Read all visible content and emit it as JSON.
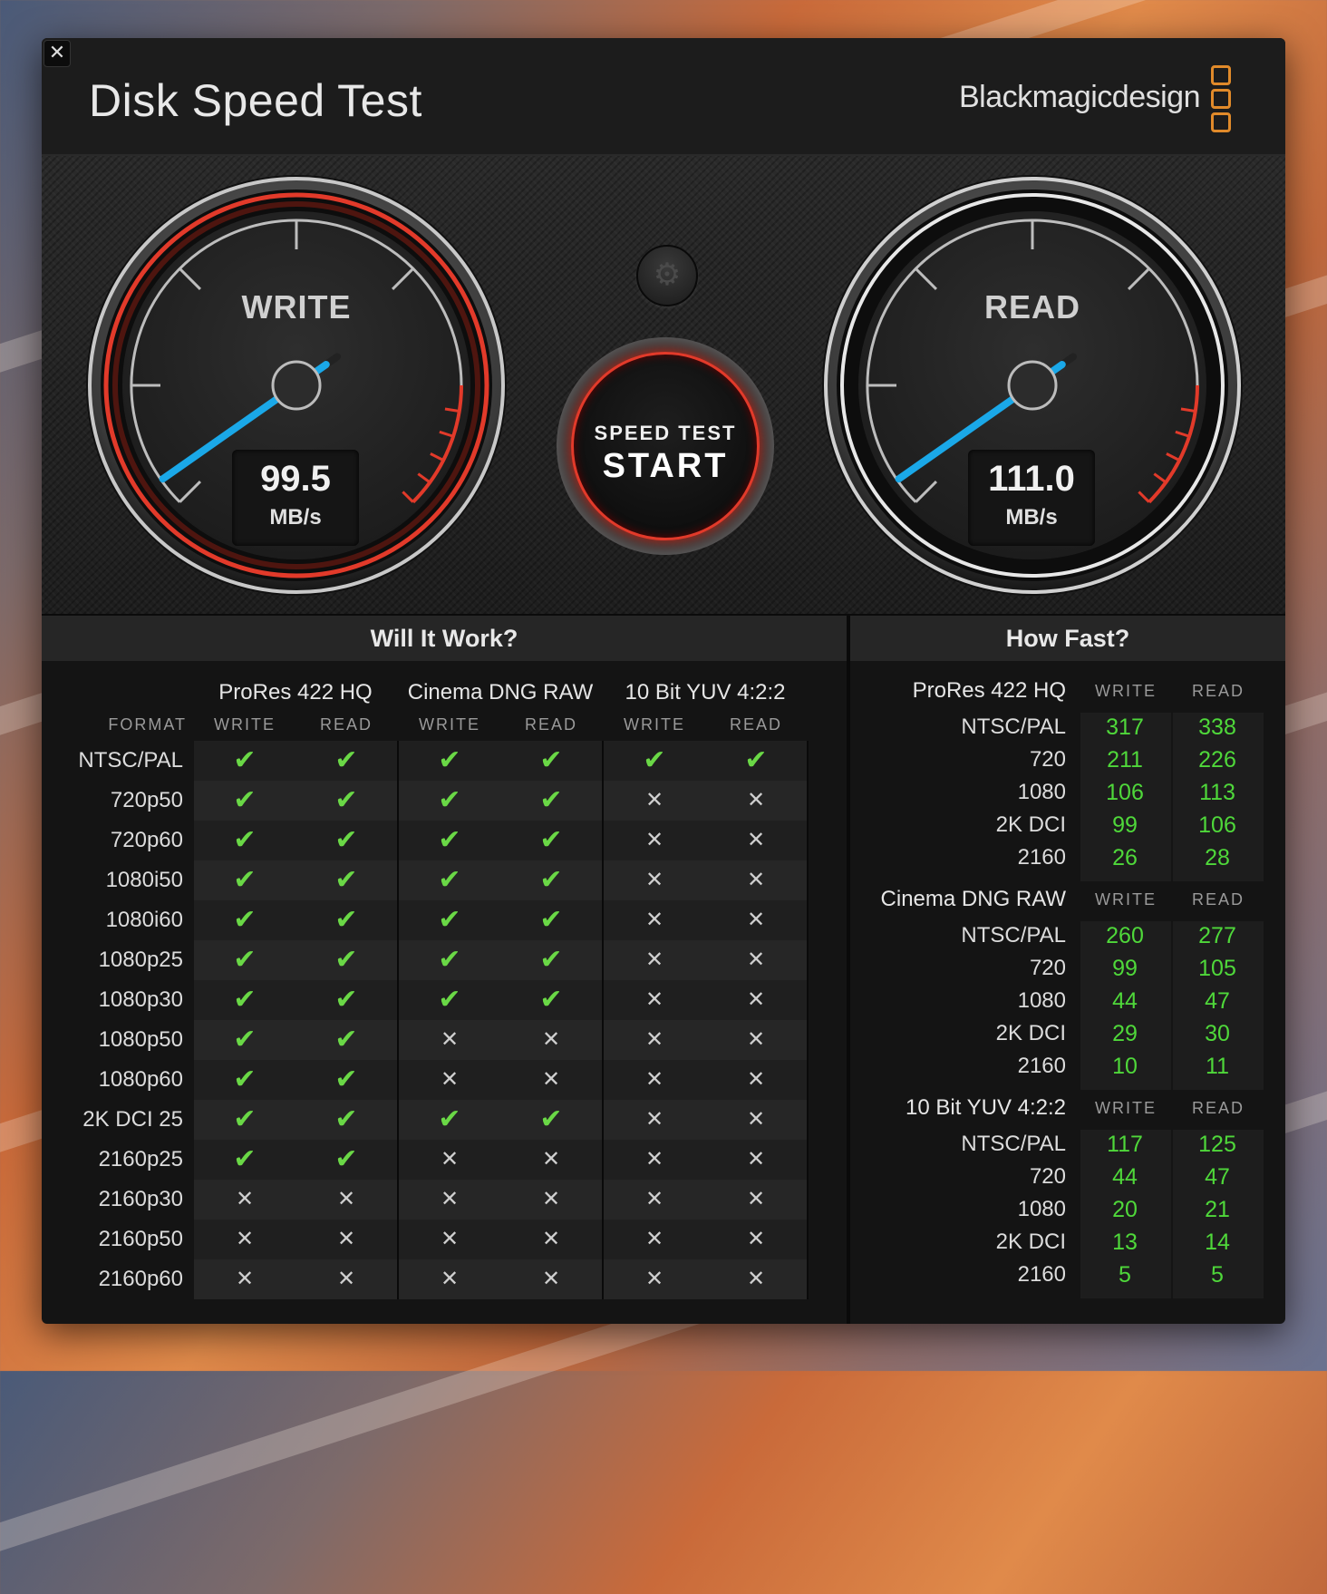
{
  "window": {
    "title": "Disk Speed Test",
    "brand": "Blackmagicdesign",
    "close_symbol": "✕"
  },
  "gauges": {
    "write": {
      "label": "WRITE",
      "value": "99.5",
      "unit": "MB/s"
    },
    "read": {
      "label": "READ",
      "value": "111.0",
      "unit": "MB/s"
    }
  },
  "start_button": {
    "top": "SPEED TEST",
    "main": "START"
  },
  "will_it_work": {
    "title": "Will It Work?",
    "format_header": "FORMAT",
    "groups": [
      "ProRes 422 HQ",
      "Cinema DNG RAW",
      "10 Bit YUV 4:2:2"
    ],
    "subcols": [
      "WRITE",
      "READ",
      "WRITE",
      "READ",
      "WRITE",
      "READ"
    ],
    "rows": [
      {
        "format": "NTSC/PAL",
        "results": [
          1,
          1,
          1,
          1,
          1,
          1
        ]
      },
      {
        "format": "720p50",
        "results": [
          1,
          1,
          1,
          1,
          0,
          0
        ]
      },
      {
        "format": "720p60",
        "results": [
          1,
          1,
          1,
          1,
          0,
          0
        ]
      },
      {
        "format": "1080i50",
        "results": [
          1,
          1,
          1,
          1,
          0,
          0
        ]
      },
      {
        "format": "1080i60",
        "results": [
          1,
          1,
          1,
          1,
          0,
          0
        ]
      },
      {
        "format": "1080p25",
        "results": [
          1,
          1,
          1,
          1,
          0,
          0
        ]
      },
      {
        "format": "1080p30",
        "results": [
          1,
          1,
          1,
          1,
          0,
          0
        ]
      },
      {
        "format": "1080p50",
        "results": [
          1,
          1,
          0,
          0,
          0,
          0
        ]
      },
      {
        "format": "1080p60",
        "results": [
          1,
          1,
          0,
          0,
          0,
          0
        ]
      },
      {
        "format": "2K DCI 25",
        "results": [
          1,
          1,
          1,
          1,
          0,
          0
        ]
      },
      {
        "format": "2160p25",
        "results": [
          1,
          1,
          0,
          0,
          0,
          0
        ]
      },
      {
        "format": "2160p30",
        "results": [
          0,
          0,
          0,
          0,
          0,
          0
        ]
      },
      {
        "format": "2160p50",
        "results": [
          0,
          0,
          0,
          0,
          0,
          0
        ]
      },
      {
        "format": "2160p60",
        "results": [
          0,
          0,
          0,
          0,
          0,
          0
        ]
      }
    ],
    "check_symbol": "✔",
    "cross_symbol": "✕"
  },
  "how_fast": {
    "title": "How Fast?",
    "write_label": "WRITE",
    "read_label": "READ",
    "groups": [
      {
        "name": "ProRes 422 HQ",
        "rows": [
          {
            "label": "NTSC/PAL",
            "write": "317",
            "read": "338"
          },
          {
            "label": "720",
            "write": "211",
            "read": "226"
          },
          {
            "label": "1080",
            "write": "106",
            "read": "113"
          },
          {
            "label": "2K DCI",
            "write": "99",
            "read": "106"
          },
          {
            "label": "2160",
            "write": "26",
            "read": "28"
          }
        ]
      },
      {
        "name": "Cinema DNG RAW",
        "rows": [
          {
            "label": "NTSC/PAL",
            "write": "260",
            "read": "277"
          },
          {
            "label": "720",
            "write": "99",
            "read": "105"
          },
          {
            "label": "1080",
            "write": "44",
            "read": "47"
          },
          {
            "label": "2K DCI",
            "write": "29",
            "read": "30"
          },
          {
            "label": "2160",
            "write": "10",
            "read": "11"
          }
        ]
      },
      {
        "name": "10 Bit YUV 4:2:2",
        "rows": [
          {
            "label": "NTSC/PAL",
            "write": "117",
            "read": "125"
          },
          {
            "label": "720",
            "write": "44",
            "read": "47"
          },
          {
            "label": "1080",
            "write": "20",
            "read": "21"
          },
          {
            "label": "2K DCI",
            "write": "13",
            "read": "14"
          },
          {
            "label": "2160",
            "write": "5",
            "read": "5"
          }
        ]
      }
    ]
  },
  "colors": {
    "accent_red": "#e23a2a",
    "needle_blue": "#1aa8e8",
    "ok_green": "#6ad846",
    "value_green": "#4fd83a",
    "logo_orange": "#e08a2a"
  }
}
